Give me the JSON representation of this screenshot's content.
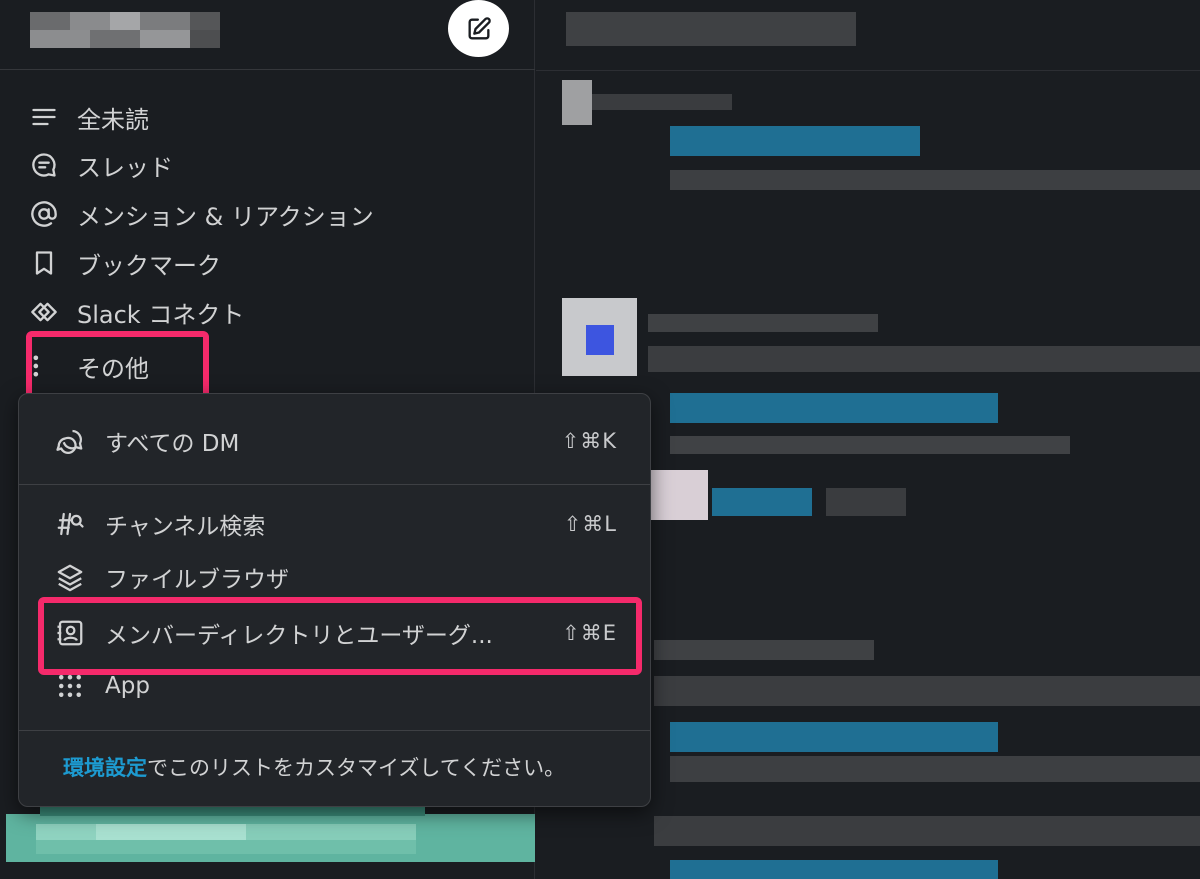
{
  "sidebar": {
    "nav_items": [
      {
        "label": "全未読",
        "icon": "list-icon"
      },
      {
        "label": "スレッド",
        "icon": "threads-icon"
      },
      {
        "label": "メンション & リアクション",
        "icon": "at-sign-icon"
      },
      {
        "label": "ブックマーク",
        "icon": "bookmark-icon"
      },
      {
        "label": "Slack コネクト",
        "icon": "slack-connect-icon"
      },
      {
        "label": "その他",
        "icon": "vertical-ellipsis-icon"
      }
    ]
  },
  "more_menu": {
    "items": [
      {
        "label": "すべての DM",
        "shortcut": "⇧⌘K",
        "icon": "dm-bubbles-icon"
      },
      {
        "label": "チャンネル検索",
        "shortcut": "⇧⌘L",
        "icon": "channel-search-icon"
      },
      {
        "label": "ファイルブラウザ",
        "shortcut": "",
        "icon": "layers-icon"
      },
      {
        "label": "メンバーディレクトリとユーザーグ...",
        "shortcut": "⇧⌘E",
        "icon": "contact-card-icon"
      },
      {
        "label": "App",
        "shortcut": "",
        "icon": "app-grid-icon"
      }
    ],
    "footer": {
      "link_text": "環境設定",
      "rest_text": "でこのリストをカスタマイズしてください。"
    }
  },
  "colors": {
    "background": "#1a1d21",
    "menu_background": "#222529",
    "highlight": "#f52a6b",
    "link": "#1d9bd1",
    "text": "#d1d2d3"
  }
}
